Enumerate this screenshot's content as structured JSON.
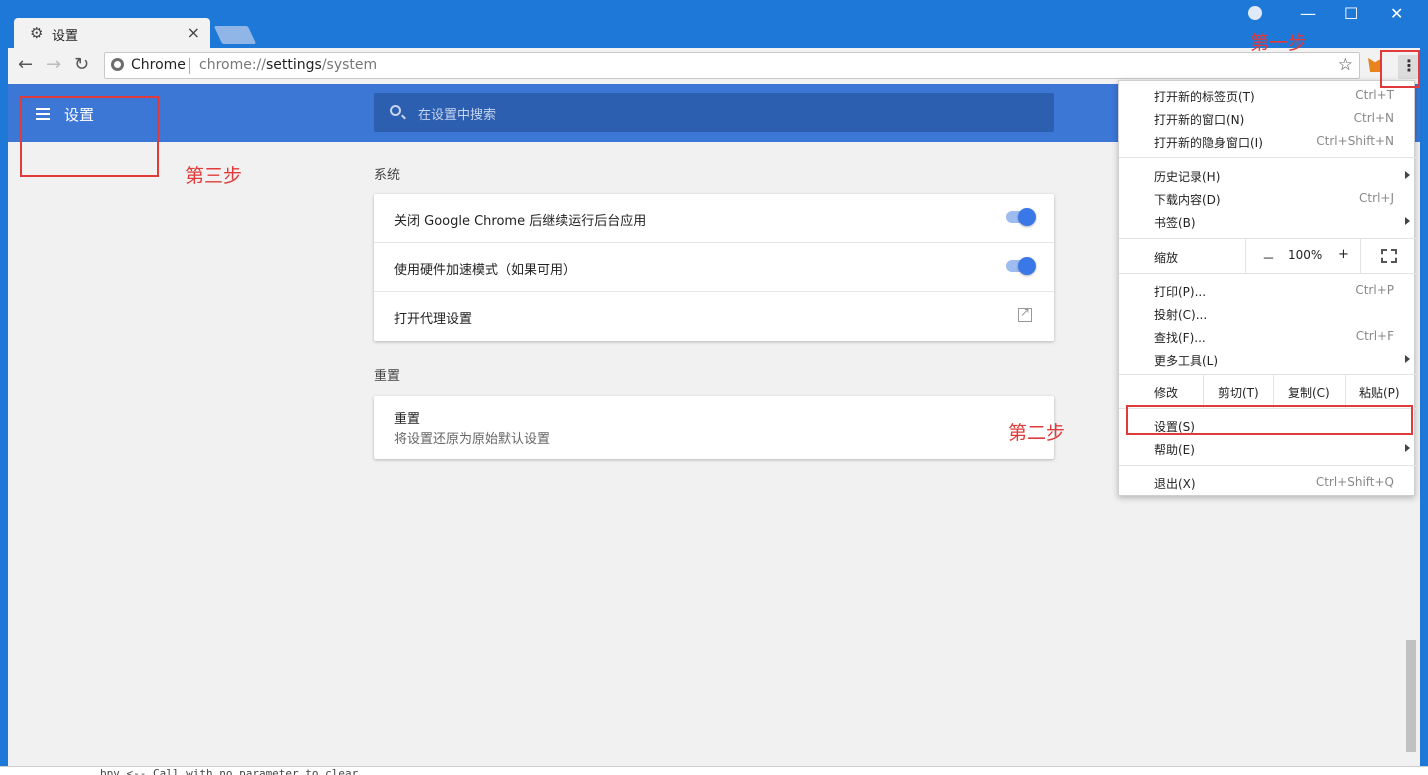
{
  "tab": {
    "title": "设置",
    "icon": "gear-icon",
    "close": "×"
  },
  "window_controls": {
    "minimize": "—",
    "maximize": "☐",
    "close": "✕"
  },
  "toolbar": {
    "back": "←",
    "forward": "→",
    "reload": "↻",
    "site_name": "Chrome",
    "url_prefix": "chrome://",
    "url_host": "settings",
    "url_path": "/system",
    "star": "☆",
    "menu": "⋮"
  },
  "header": {
    "title": "设置",
    "search_placeholder": "在设置中搜索"
  },
  "system": {
    "section_label": "系统",
    "rows": [
      {
        "label": "关闭 Google Chrome 后继续运行后台应用",
        "control": "toggle",
        "on": true
      },
      {
        "label": "使用硬件加速模式（如果可用）",
        "control": "toggle",
        "on": true
      },
      {
        "label": "打开代理设置",
        "control": "external-link"
      }
    ]
  },
  "reset": {
    "section_label": "重置",
    "title": "重置",
    "subtitle": "将设置还原为原始默认设置"
  },
  "bottom_text": "bpv        <-- Call with no parameter to clear",
  "menu": {
    "new_tab": "打开新的标签页(T)",
    "new_tab_short": "Ctrl+T",
    "new_window": "打开新的窗口(N)",
    "new_window_short": "Ctrl+N",
    "incognito": "打开新的隐身窗口(I)",
    "incognito_short": "Ctrl+Shift+N",
    "history": "历史记录(H)",
    "downloads": "下载内容(D)",
    "downloads_short": "Ctrl+J",
    "bookmarks": "书签(B)",
    "zoom_label": "缩放",
    "zoom_minus": "－",
    "zoom_value": "100%",
    "zoom_plus": "+",
    "print": "打印(P)...",
    "print_short": "Ctrl+P",
    "cast": "投射(C)...",
    "find": "查找(F)...",
    "find_short": "Ctrl+F",
    "more_tools": "更多工具(L)",
    "edit_label": "修改",
    "cut": "剪切(T)",
    "copy": "复制(C)",
    "paste": "粘贴(P)",
    "settings": "设置(S)",
    "help": "帮助(E)",
    "exit": "退出(X)",
    "exit_short": "Ctrl+Shift+Q"
  },
  "annotations": {
    "step1": "第一步",
    "step2": "第二步",
    "step3": "第三步"
  },
  "colors": {
    "accent": "#3c77d6",
    "annotation": "#e03a3a",
    "titlebar": "#1e78d7"
  }
}
